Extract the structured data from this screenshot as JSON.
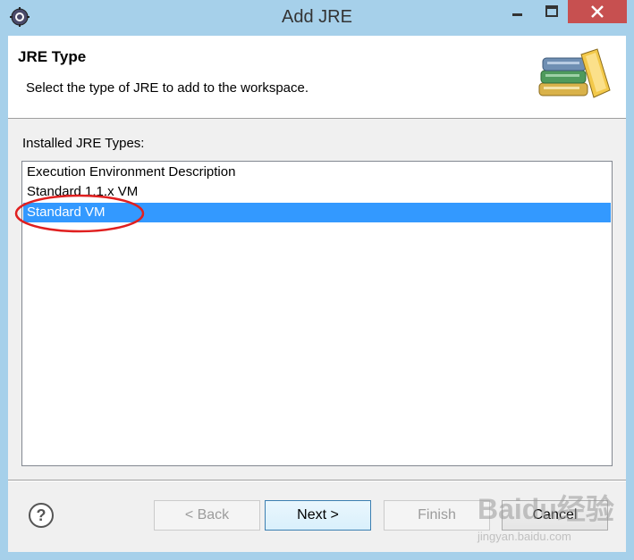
{
  "window": {
    "title": "Add JRE"
  },
  "header": {
    "title": "JRE Type",
    "description": "Select the type of JRE to add to the workspace."
  },
  "installed": {
    "label": "Installed JRE Types:",
    "items": [
      {
        "label": "Execution Environment Description",
        "selected": false
      },
      {
        "label": "Standard 1.1.x VM",
        "selected": false
      },
      {
        "label": "Standard VM",
        "selected": true
      }
    ]
  },
  "buttons": {
    "help": "?",
    "back": "< Back",
    "next": "Next >",
    "finish": "Finish",
    "cancel": "Cancel"
  },
  "annotation": {
    "color": "#e02020"
  },
  "watermark": {
    "text": "Baidu经验",
    "url": "jingyan.baidu.com"
  },
  "colors": {
    "titlebar": "#a6d0ea",
    "selection": "#3399ff",
    "close_button": "#c75050"
  },
  "icons": {
    "app": "eclipse-gear-icon",
    "header": "books-icon",
    "help": "question-circle-icon"
  }
}
